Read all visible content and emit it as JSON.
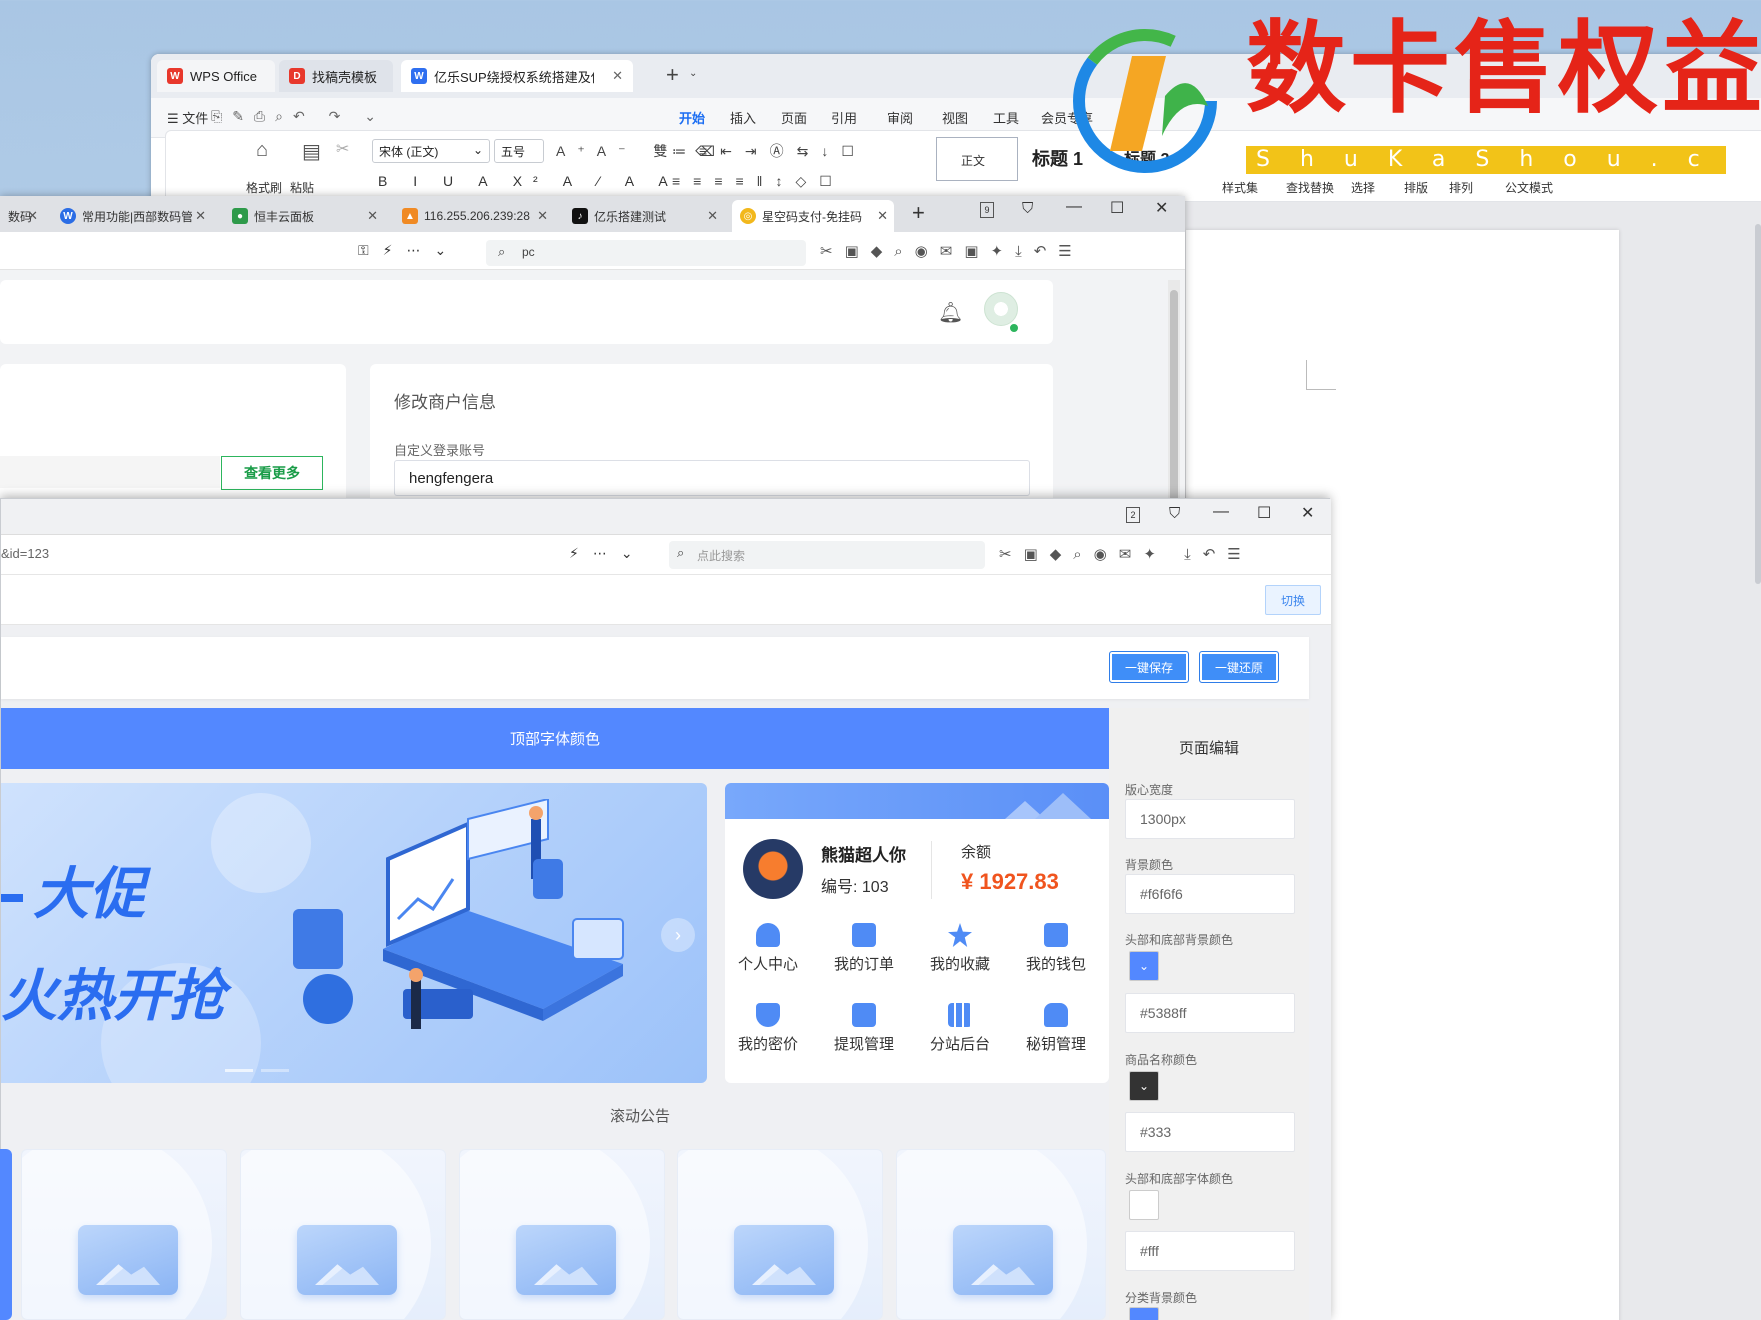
{
  "wps": {
    "tabs": [
      {
        "label": "WPS Office"
      },
      {
        "label": "找稿壳模板"
      },
      {
        "label": "亿乐SUP绕授权系统搭建及使用"
      }
    ],
    "menu": {
      "file": "文件",
      "items": [
        "开始",
        "插入",
        "页面",
        "引用",
        "审阅",
        "视图",
        "工具",
        "会员专享"
      ]
    },
    "ribbon": {
      "format_painter": "格式刷",
      "paste": "粘贴",
      "font_name": "宋体 (正文)",
      "font_size": "五号",
      "style_normal": "正文",
      "style_h1": "标题 1",
      "style_h2": "标题 2",
      "style_set": "样式集",
      "find_replace": "查找替换",
      "select": "选择",
      "layout": "排版",
      "arrange": "排列",
      "official": "公文模式"
    }
  },
  "watermark": {
    "title": "数卡售权益",
    "subtitle": "ShuKaShou.com"
  },
  "browser1": {
    "tabs": [
      {
        "label": "数码"
      },
      {
        "label": "常用功能|西部数码管"
      },
      {
        "label": "恒丰云面板"
      },
      {
        "label": "116.255.206.239:28"
      },
      {
        "label": "亿乐搭建测试"
      },
      {
        "label": "星空码支付-免挂码"
      }
    ],
    "tab_count": "9",
    "search": "pc",
    "more_button": "查看更多",
    "merchant_title": "修改商户信息",
    "login_label": "自定义登录账号",
    "login_value": "hengfengera"
  },
  "browser2": {
    "tab_count": "2",
    "url": "&id=123",
    "search_placeholder": "点此搜索",
    "switch_button": "切换",
    "save_button": "一键保存",
    "restore_button": "一键还原",
    "banner_bar": "顶部字体颜色",
    "promo_line1": "大促",
    "promo_line2": "火热开抢",
    "user": {
      "name": "熊猫超人你",
      "id_label": "编号: 103",
      "balance_label": "余额",
      "balance": "¥ 1927.83"
    },
    "menu": [
      {
        "label": "个人中心",
        "icon": "user-icon"
      },
      {
        "label": "我的订单",
        "icon": "order-icon"
      },
      {
        "label": "我的收藏",
        "icon": "star-icon"
      },
      {
        "label": "我的钱包",
        "icon": "wallet-icon"
      },
      {
        "label": "我的密价",
        "icon": "shield-icon"
      },
      {
        "label": "提现管理",
        "icon": "withdraw-icon"
      },
      {
        "label": "分站后台",
        "icon": "grid-icon"
      },
      {
        "label": "秘钥管理",
        "icon": "lock-icon"
      }
    ],
    "notice": "滚动公告",
    "editor": {
      "title": "页面编辑",
      "width_label": "版心宽度",
      "width_value": "1300px",
      "bg_label": "背景颜色",
      "bg_value": "#f6f6f6",
      "header_bg_label": "头部和底部背景颜色",
      "header_bg_value": "#5388ff",
      "name_color_label": "商品名称颜色",
      "name_color_value": "#333",
      "header_font_label": "头部和底部字体颜色",
      "header_font_value": "#fff",
      "category_bg_label": "分类背景颜色"
    }
  },
  "colors": {
    "accent": "#5388ff",
    "wps_blue": "#1c6ef2",
    "price": "#f0541e",
    "watermark_red": "#e52418",
    "watermark_yellow": "#f2c318"
  }
}
